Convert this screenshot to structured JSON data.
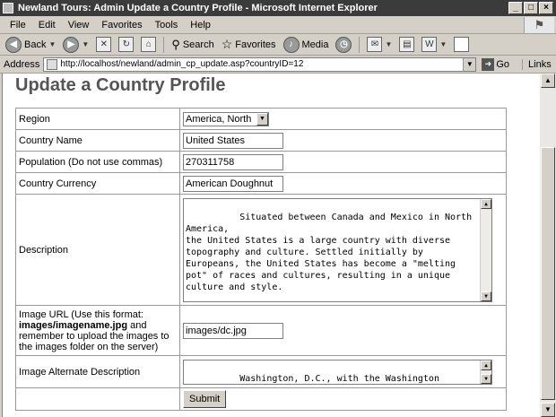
{
  "window": {
    "title": "Newland Tours: Admin Update a Country Profile - Microsoft Internet Explorer",
    "buttons": [
      "_",
      "□",
      "×"
    ]
  },
  "menu": [
    "File",
    "Edit",
    "View",
    "Favorites",
    "Tools",
    "Help"
  ],
  "toolbar": {
    "back": "Back",
    "search": "Search",
    "favorites": "Favorites",
    "media": "Media"
  },
  "address": {
    "label": "Address",
    "url": "http://localhost/newland/admin_cp_update.asp?countryID=12",
    "go": "Go",
    "links": "Links"
  },
  "page": {
    "title": "Update a Country Profile",
    "region_label": "Region",
    "region_value": "America, North",
    "country_label": "Country Name",
    "country_value": "United States",
    "population_label": "Population (Do not use commas)",
    "population_value": "270311758",
    "currency_label": "Country Currency",
    "currency_value": "American Doughnut",
    "description_label": "Description",
    "description_value": "Situated between Canada and Mexico in North America,\nthe United States is a large country with diverse\ntopography and culture. Settled initially by\nEuropeans, the United States has become a \"melting\npot\" of races and cultures, resulting in a unique\nculture and style.",
    "image_label_pre": "Image URL (Use this format:",
    "image_label_format": "images/imagename.jpg",
    "image_label_post": "and remember to upload the images to the images folder on the server)",
    "image_value": "images/dc.jpg",
    "alt_label": "Image Alternate Description",
    "alt_value": "Washington, D.C., with the Washington Monument in the\nbackground",
    "submit_label": "Submit"
  }
}
